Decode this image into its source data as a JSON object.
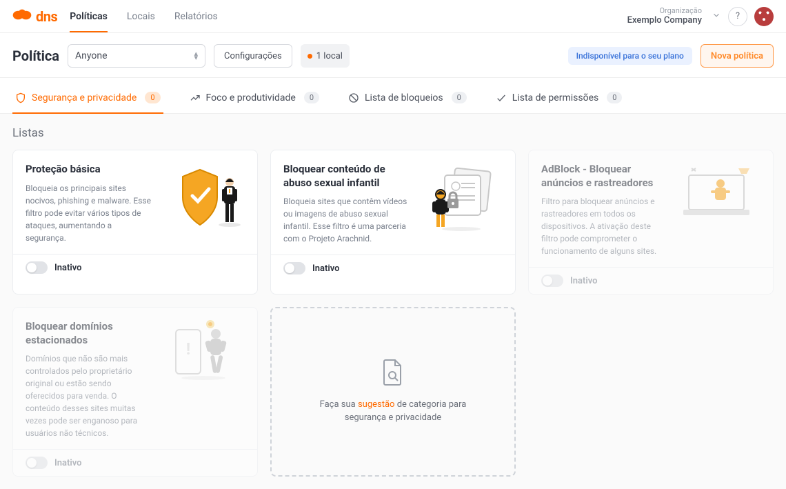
{
  "brand": {
    "text": "dns"
  },
  "nav": {
    "items": [
      {
        "label": "Políticas",
        "active": true
      },
      {
        "label": "Locais",
        "active": false
      },
      {
        "label": "Relatórios",
        "active": false
      }
    ]
  },
  "org": {
    "label": "Organização",
    "name": "Exemplo Company"
  },
  "help": "?",
  "page": {
    "title": "Política"
  },
  "policy_select": {
    "value": "Anyone"
  },
  "config_button": "Configurações",
  "location_chip": {
    "text": "1 local"
  },
  "plan_badge": "Indisponível para o seu plano",
  "new_button": "Nova política",
  "filter_tabs": [
    {
      "label": "Segurança e privacidade",
      "count": "0",
      "icon": "shield"
    },
    {
      "label": "Foco e produtividade",
      "count": "0",
      "icon": "trend"
    },
    {
      "label": "Lista de bloqueios",
      "count": "0",
      "icon": "block"
    },
    {
      "label": "Lista de permissões",
      "count": "0",
      "icon": "check"
    }
  ],
  "section_title": "Listas",
  "cards": [
    {
      "title": "Proteção básica",
      "desc": "Bloqueia os principais sites nocivos, phishing e malware. Esse filtro pode evitar vários tipos de ataques, aumentando a segurança.",
      "status": "Inativo",
      "disabled": false
    },
    {
      "title": "Bloquear conteúdo de abuso sexual infantil",
      "desc": "Bloqueia sites que contêm vídeos ou imagens de abuso sexual infantil. Esse filtro é uma parceria com o Projeto Arachnid.",
      "status": "Inativo",
      "disabled": false
    },
    {
      "title": "AdBlock - Bloquear anúncios e rastreadores",
      "desc": "Filtro para bloquear anúncios e rastreadores em todos os dispositivos. A ativação deste filtro pode comprometer o funcionamento de alguns sites.",
      "status": "Inativo",
      "disabled": true
    },
    {
      "title": "Bloquear domínios estacionados",
      "desc": "Domínios que não são mais controlados pelo proprietário original ou estão sendo oferecidos para venda. O conteúdo desses sites muitas vezes pode ser enganoso para usuários não técnicos.",
      "status": "Inativo",
      "disabled": true
    }
  ],
  "suggest": {
    "pre": "Faça sua ",
    "highlight": "sugestão",
    "post": " de categoria para segurança e privacidade"
  }
}
